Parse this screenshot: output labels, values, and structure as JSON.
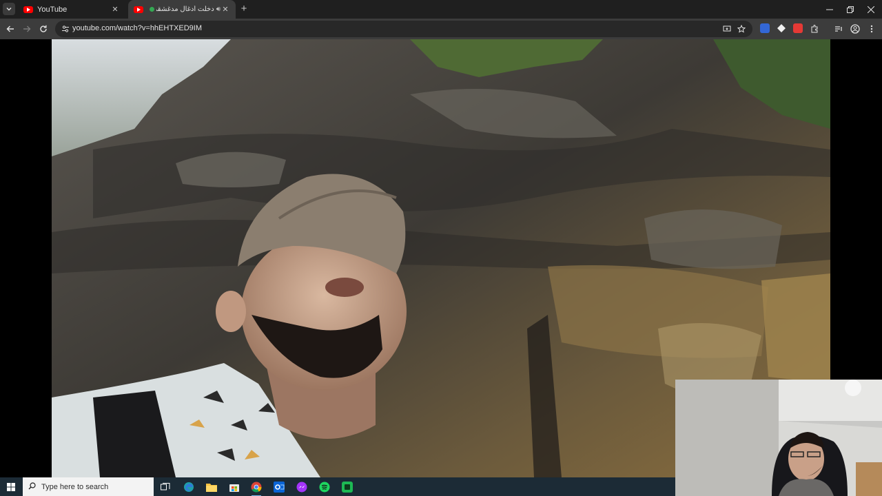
{
  "browser": {
    "tabs": [
      {
        "title": "YouTube",
        "active": false
      },
      {
        "title": "دخلت أدغال مدغشقر | ...",
        "active": true
      }
    ],
    "new_tab_label": "+",
    "url": "youtube.com/watch?v=hhEHTXED9IM"
  },
  "taskbar": {
    "search_placeholder": "Type here to search",
    "apps": [
      "task-view",
      "edge",
      "file-explorer",
      "store",
      "chrome",
      "outlook",
      "messenger",
      "spotify",
      "app-green"
    ]
  },
  "colors": {
    "tab_strip": "#1f1f1f",
    "toolbar": "#3c3c3c",
    "omnibox": "#282828",
    "taskbar": "#1c2b36",
    "youtube_red": "#ff0000"
  }
}
